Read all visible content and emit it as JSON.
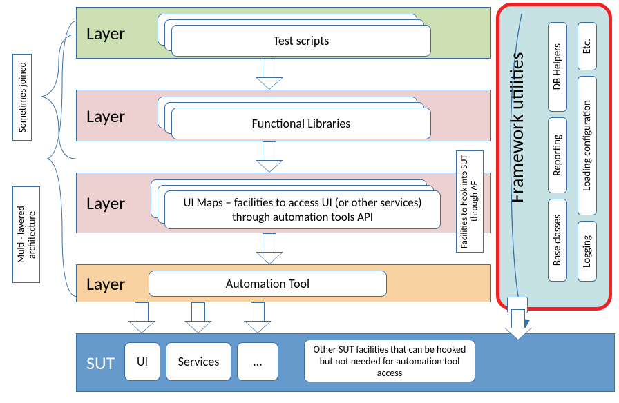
{
  "layers": [
    {
      "label": "Layer",
      "content": "Test scripts",
      "bg": "#cce0b3"
    },
    {
      "label": "Layer",
      "content": "Functional Libraries",
      "bg": "#edd0d0"
    },
    {
      "label": "Layer",
      "content": "UI Maps – facilities to access UI (or other services) through automation tools API",
      "bg": "#edd0d0"
    },
    {
      "label": "Layer",
      "content": "Automation Tool",
      "bg": "#f8d2a0"
    }
  ],
  "sut": {
    "label": "SUT",
    "boxes": [
      "UI",
      "Services",
      "…"
    ],
    "note": "Other SUT facilities that can be hooked but not needed for automation tool access"
  },
  "framework": {
    "title": "Framework utilities",
    "utils": [
      "Base classes",
      "Reporting",
      "DB Helpers",
      "Logging",
      "Loading configuration",
      "Etc."
    ]
  },
  "annotations": {
    "sometimes_joined": "Sometimes joined",
    "multi_layered": "Multi - layered architecture",
    "hook_facilities": "Facilities to hook into SUT through AF"
  }
}
